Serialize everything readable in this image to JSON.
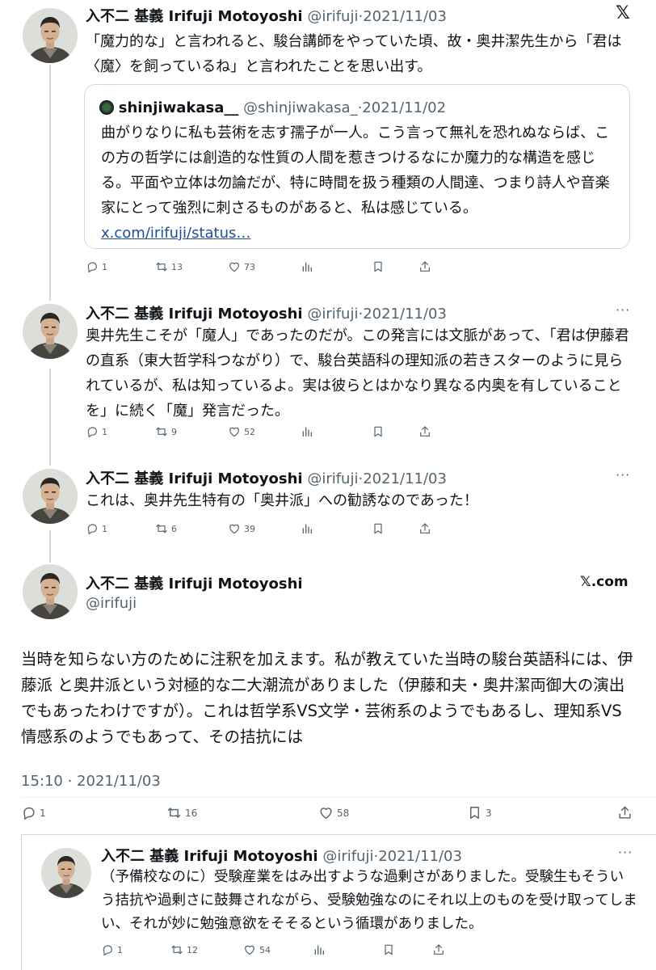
{
  "x_logo": "𝕏",
  "x_com": "𝕏.com",
  "more": "···",
  "tweets": [
    {
      "name": "入不二 基義 Irifuji Motoyoshi",
      "handle": "@irifuji",
      "date": "·2021/11/03",
      "text": "「魔力的な」と言われると、駿台講師をやっていた頃、故・奥井潔先生から「君は〈魔〉を飼っているね」と言われたことを思い出す。",
      "quote": {
        "name": "shinjiwakasa__",
        "handle": "@shinjiwakasa_",
        "date": "·2021/11/02",
        "text": "曲がりなりに私も芸術を志す孺子が一人。こう言って無礼を恐れぬならば、この方の哲学には創造的な性質の人間を惹きつけるなにか魔力的な構造を感じる。平面や立体は勿論だが、特に時間を扱う種類の人間達、つまり詩人や音楽家にとって強烈に刺さるものがあると、私は感じている。",
        "link": "x.com/irifuji/status…"
      },
      "replies": "1",
      "retweets": "13",
      "likes": "73"
    },
    {
      "name": "入不二 基義 Irifuji Motoyoshi",
      "handle": "@irifuji",
      "date": "·2021/11/03",
      "text": "奥井先生こそが「魔人」であったのだが。この発言には文脈があって、「君は伊藤君の直系（東大哲学科つながり）で、駿台英語科の理知派の若きスターのように見られているが、私は知っているよ。実は彼らとはかなり異なる内奥を有していることを」に続く「魔」発言だった。",
      "replies": "1",
      "retweets": "9",
      "likes": "52"
    },
    {
      "name": "入不二 基義 Irifuji Motoyoshi",
      "handle": "@irifuji",
      "date": "·2021/11/03",
      "text": "これは、奥井先生特有の「奥井派」への勧誘なのであった！",
      "replies": "1",
      "retweets": "6",
      "likes": "39"
    }
  ],
  "main": {
    "name": "入不二 基義 Irifuji Motoyoshi",
    "handle": "@irifuji",
    "text": "当時を知らない方のために注釈を加えます。私が教えていた当時の駿台英語科には、伊藤派 と奥井派という対極的な二大潮流がありました（伊藤和夫・奥井潔両御大の演出でもあったわけですが）。これは哲学系VS文学・芸術系のようでもあるし、理知系VS情感系のようでもあって、その拮抗には",
    "timestamp": "15:10 · 2021/11/03",
    "replies": "1",
    "retweets": "16",
    "likes": "58",
    "bookmarks": "3"
  },
  "reply": {
    "name": "入不二 基義 Irifuji Motoyoshi",
    "handle": "@irifuji",
    "date": "·2021/11/03",
    "text": "（予備校なのに）受験産業をはみ出すような過剰さがありました。受験生もそういう拮抗や過剰さに鼓舞されながら、受験勉強なのにそれ以上のものを受け取ってしまい、それが妙に勉強意欲をそそるという循環がありました。",
    "replies": "1",
    "retweets": "12",
    "likes": "54"
  }
}
